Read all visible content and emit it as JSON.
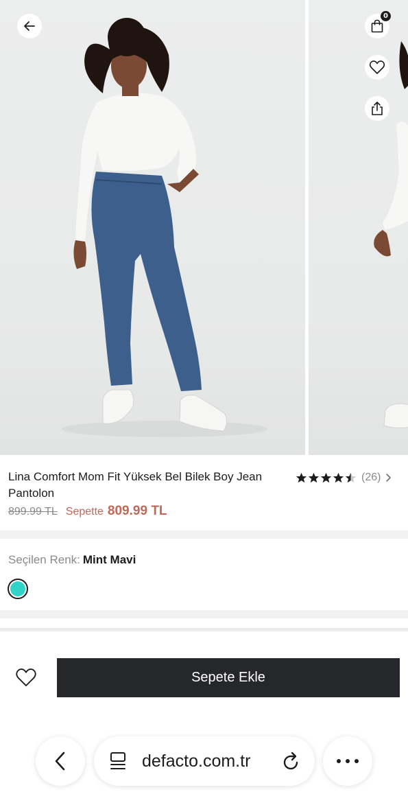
{
  "header": {
    "cart_count": "0",
    "icons": [
      "arrow-left-icon",
      "shopping-bag-icon",
      "heart-icon",
      "share-icon"
    ]
  },
  "product": {
    "title": "Lina Comfort Mom Fit Yüksek Bel Bilek Boy Jean Pantolon",
    "rating": 4.5,
    "rating_count": "(26)",
    "old_price": "899.99 TL",
    "basket_label": "Sepette",
    "basket_price": "809.99 TL"
  },
  "color": {
    "label": "Seçilen Renk:",
    "value": "Mint Mavi",
    "swatch_hex": "#2fd3c8"
  },
  "actions": {
    "add_to_cart": "Sepete Ekle"
  },
  "browser": {
    "url": "defacto.com.tr",
    "icons": [
      "chevron-left-icon",
      "reader-icon",
      "reload-icon",
      "more-icon"
    ]
  },
  "colors": {
    "accent_price": "#c26857",
    "button_bg": "#26272b"
  }
}
